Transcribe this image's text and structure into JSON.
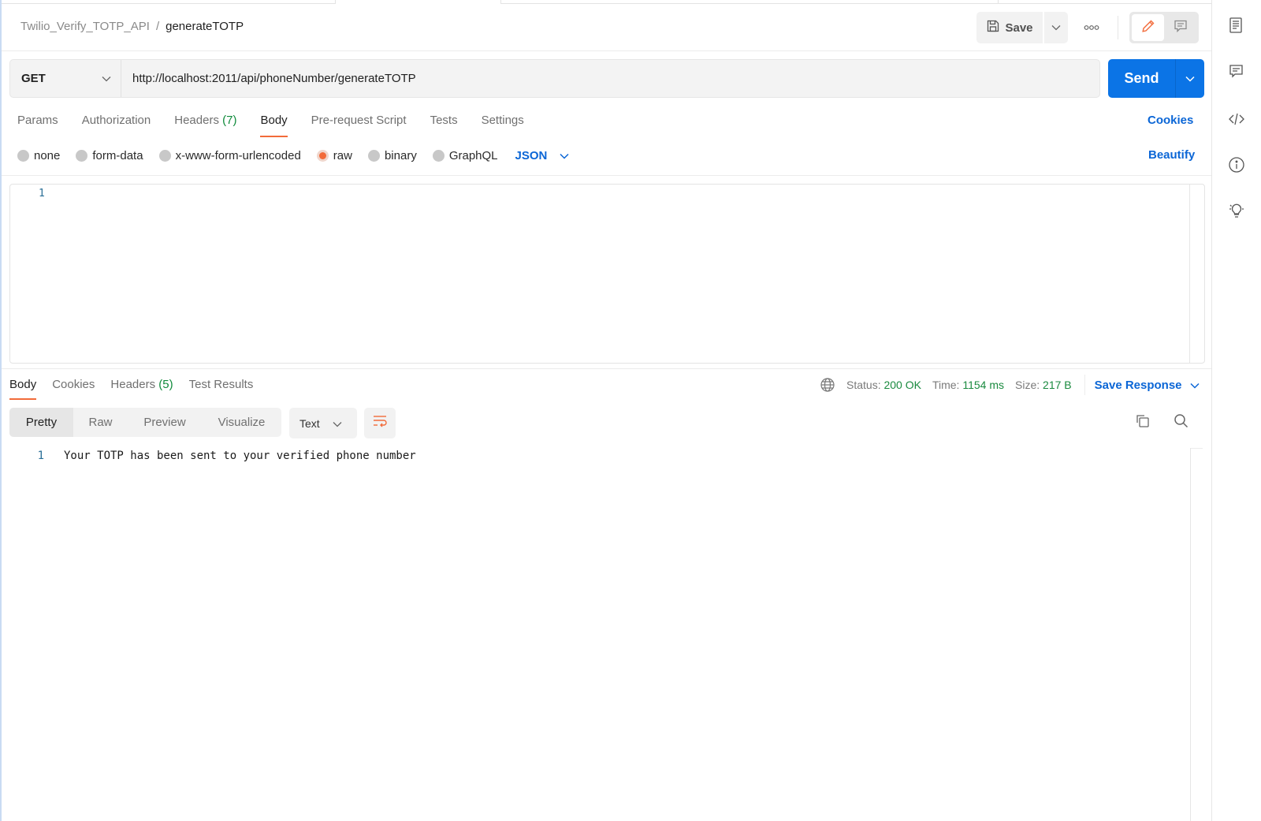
{
  "header": {
    "collection": "Twilio_Verify_TOTP_API",
    "separator": "/",
    "request_name": "generateTOTP",
    "save_label": "Save"
  },
  "request": {
    "method": "GET",
    "url": "http://localhost:2011/api/phoneNumber/generateTOTP",
    "send_label": "Send",
    "tabs": [
      {
        "label": "Params",
        "count": null,
        "active": false
      },
      {
        "label": "Authorization",
        "count": null,
        "active": false
      },
      {
        "label": "Headers",
        "count": "(7)",
        "active": false
      },
      {
        "label": "Body",
        "count": null,
        "active": true
      },
      {
        "label": "Pre-request Script",
        "count": null,
        "active": false
      },
      {
        "label": "Tests",
        "count": null,
        "active": false
      },
      {
        "label": "Settings",
        "count": null,
        "active": false
      }
    ],
    "cookies_label": "Cookies",
    "body_types": [
      {
        "label": "none",
        "selected": false
      },
      {
        "label": "form-data",
        "selected": false
      },
      {
        "label": "x-www-form-urlencoded",
        "selected": false
      },
      {
        "label": "raw",
        "selected": true
      },
      {
        "label": "binary",
        "selected": false
      },
      {
        "label": "GraphQL",
        "selected": false
      }
    ],
    "raw_language": "JSON",
    "beautify_label": "Beautify",
    "editor_line_number": "1"
  },
  "response": {
    "tabs": [
      {
        "label": "Body",
        "count": null,
        "active": true
      },
      {
        "label": "Cookies",
        "count": null,
        "active": false
      },
      {
        "label": "Headers",
        "count": "(5)",
        "active": false
      },
      {
        "label": "Test Results",
        "count": null,
        "active": false
      }
    ],
    "status_label": "Status:",
    "status_value": "200 OK",
    "time_label": "Time:",
    "time_value": "1154 ms",
    "size_label": "Size:",
    "size_value": "217 B",
    "save_response_label": "Save Response",
    "view_modes": [
      {
        "label": "Pretty",
        "active": true
      },
      {
        "label": "Raw",
        "active": false
      },
      {
        "label": "Preview",
        "active": false
      },
      {
        "label": "Visualize",
        "active": false
      }
    ],
    "format": "Text",
    "lines": [
      {
        "number": "1",
        "text": "Your TOTP has been sent to your verified phone number"
      }
    ]
  },
  "icons": {
    "save": "floppy-disk-icon",
    "more": "ellipsis-icon",
    "edit": "pencil-icon",
    "comments": "comment-icon",
    "globe": "globe-icon",
    "copy": "copy-icon",
    "search": "search-icon",
    "wrap": "wrap-lines-icon",
    "rail": [
      "documentation-icon",
      "comments-icon",
      "code-icon",
      "info-icon",
      "lightbulb-icon"
    ]
  },
  "colors": {
    "accent": "#f26b3a",
    "primary": "#0b74e6",
    "link": "#0b66d6",
    "success": "#1a8a3f"
  }
}
